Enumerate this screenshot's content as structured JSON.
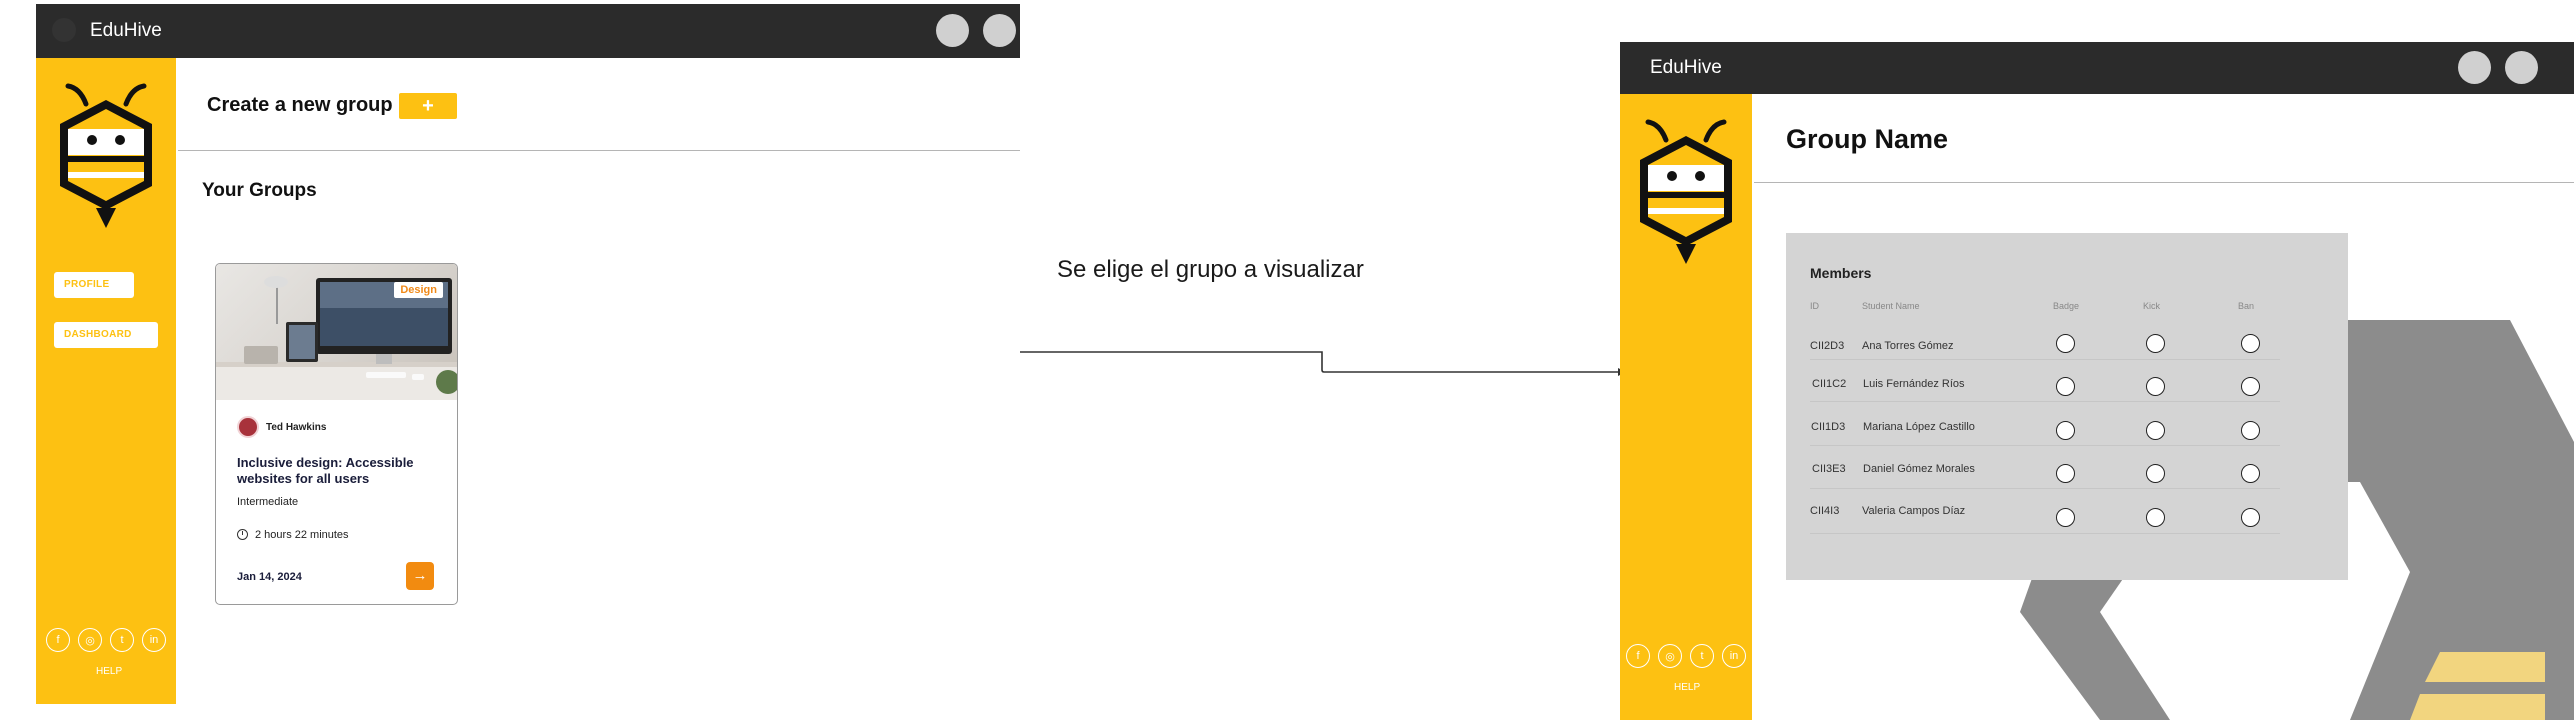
{
  "screen1": {
    "app_title": "EduHive",
    "sidebar": {
      "profile_label": "PROFILE",
      "dashboard_label": "DASHBOARD",
      "help_label": "HELP"
    },
    "socials": [
      {
        "icon": "facebook-icon",
        "glyph": "f"
      },
      {
        "icon": "instagram-icon",
        "glyph": "◎"
      },
      {
        "icon": "twitter-icon",
        "glyph": "t"
      },
      {
        "icon": "linkedin-icon",
        "glyph": "in"
      }
    ],
    "create_group_label": "Create a new group",
    "create_group_button": "+",
    "your_groups_heading": "Your Groups",
    "card": {
      "tag": "Design",
      "author": "Ted Hawkins",
      "title": "Inclusive design: Accessible websites for all users",
      "level": "Intermediate",
      "duration": "2 hours 22 minutes",
      "date": "Jan 14, 2024",
      "go_button": "→"
    }
  },
  "transition_label": "Se elige el grupo a visualizar",
  "screen2": {
    "app_title": "EduHive",
    "group_name": "Group Name",
    "help_label": "HELP",
    "members": {
      "title": "Members",
      "columns": [
        "ID",
        "Student Name",
        "Badge",
        "Kick",
        "Ban"
      ],
      "rows": [
        {
          "id": "CII2D3",
          "name": "Ana Torres Gómez"
        },
        {
          "id": "CII1C2",
          "name": "Luis Fernández Ríos"
        },
        {
          "id": "CII1D3",
          "name": "Mariana López Castillo"
        },
        {
          "id": "CII3E3",
          "name": "Daniel Gómez Morales"
        },
        {
          "id": "CII4I3",
          "name": "Valeria Campos Díaz"
        }
      ]
    }
  },
  "colors": {
    "brand_yellow": "#fdc112",
    "titlebar": "#2b2b2b",
    "accent_orange": "#f28b10"
  }
}
